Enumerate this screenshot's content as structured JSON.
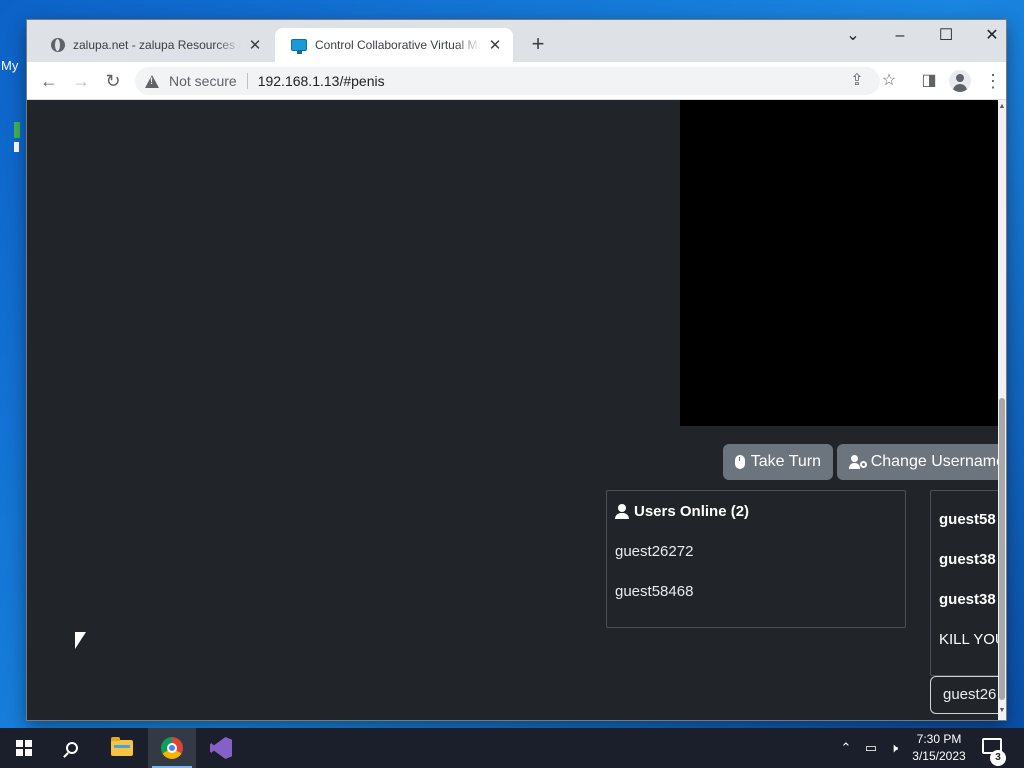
{
  "desktop": {
    "label": "My"
  },
  "browser": {
    "tabs": [
      {
        "title": "zalupa.net - zalupa Resources and Information",
        "icon": "globe-icon",
        "active": false
      },
      {
        "title": "Control Collaborative Virtual Machine",
        "icon": "monitor-icon",
        "active": true
      }
    ],
    "new_tab": "+",
    "address": {
      "security_label": "Not secure",
      "url": "192.168.1.13/#penis"
    }
  },
  "page": {
    "buttons": {
      "take_turn": "Take Turn",
      "change_username": "Change Username"
    },
    "users_online": {
      "heading": "Users Online (2)",
      "users": [
        "guest26272",
        "guest58468"
      ]
    },
    "chat": {
      "messages": [
        {
          "text": "guest58",
          "bold": true
        },
        {
          "text": "guest38",
          "bold": true
        },
        {
          "text": "guest38",
          "bold": true
        },
        {
          "text": "KILL YOU",
          "bold": false
        }
      ],
      "input_value": "guest26"
    }
  },
  "taskbar": {
    "apps": [
      "start-button",
      "search",
      "file-explorer",
      "chrome",
      "visual-studio"
    ],
    "clock": {
      "time": "7:30 PM",
      "date": "3/15/2023"
    },
    "notification_count": "3"
  },
  "colors": {
    "page_background": "#212529",
    "button": "#6c757d",
    "panel_border": "#495057"
  }
}
